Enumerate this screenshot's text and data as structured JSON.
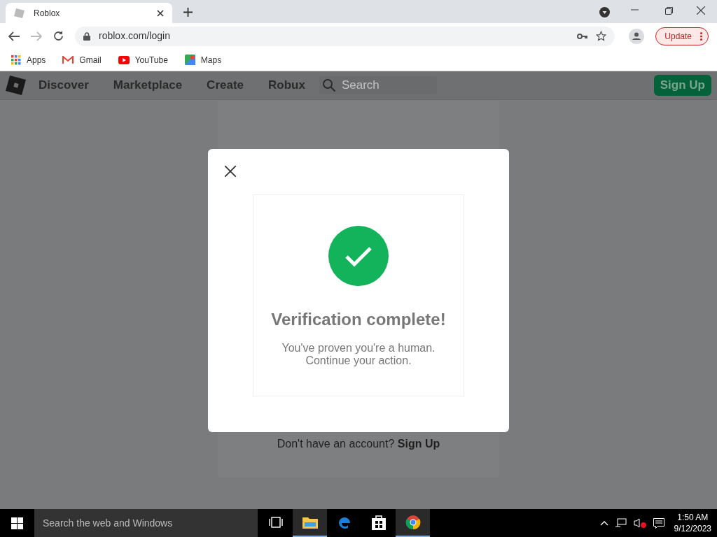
{
  "browser": {
    "tab": {
      "title": "Roblox",
      "selected": true
    },
    "url": "roblox.com/login",
    "update_button": "Update",
    "bookmarks": [
      {
        "kind": "apps",
        "label": "Apps"
      },
      {
        "kind": "gmail",
        "label": "Gmail"
      },
      {
        "kind": "youtube",
        "label": "YouTube"
      },
      {
        "kind": "maps",
        "label": "Maps"
      }
    ]
  },
  "site_nav": {
    "items": [
      "Discover",
      "Marketplace",
      "Create",
      "Robux"
    ],
    "search": {
      "placeholder": "Search"
    },
    "signup_button": "Sign Up"
  },
  "login_page": {
    "signup_prompt": {
      "text": "Don't have an account?",
      "link": "Sign Up"
    }
  },
  "modal": {
    "title": "Verification complete!",
    "lines": [
      "You've proven you're a human.",
      "Continue your action."
    ]
  },
  "taskbar": {
    "search_placeholder": "Search the web and Windows",
    "apps": [
      {
        "kind": "task-view",
        "active": false
      },
      {
        "kind": "file-explorer",
        "active": true
      },
      {
        "kind": "edge",
        "active": false
      },
      {
        "kind": "store",
        "active": false
      },
      {
        "kind": "chrome",
        "active": true
      }
    ],
    "time": "1:50 AM",
    "date": "9/12/2023"
  }
}
